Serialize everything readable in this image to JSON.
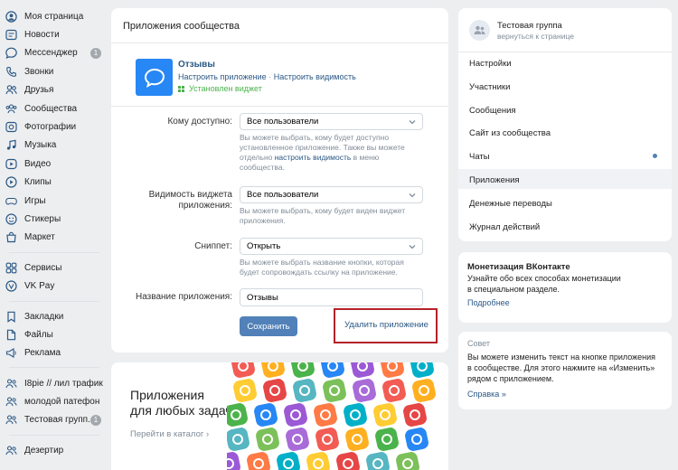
{
  "nav": {
    "items": [
      {
        "label": "Моя страница",
        "icon": "user-circle-icon"
      },
      {
        "label": "Новости",
        "icon": "news-icon"
      },
      {
        "label": "Мессенджер",
        "icon": "message-icon",
        "badge": "1"
      },
      {
        "label": "Звонки",
        "icon": "phone-icon"
      },
      {
        "label": "Друзья",
        "icon": "friends-icon"
      },
      {
        "label": "Сообщества",
        "icon": "groups-icon"
      },
      {
        "label": "Фотографии",
        "icon": "photo-icon"
      },
      {
        "label": "Музыка",
        "icon": "music-icon"
      },
      {
        "label": "Видео",
        "icon": "video-icon"
      },
      {
        "label": "Клипы",
        "icon": "clips-icon"
      },
      {
        "label": "Игры",
        "icon": "games-icon"
      },
      {
        "label": "Стикеры",
        "icon": "sticker-icon"
      },
      {
        "label": "Маркет",
        "icon": "market-icon"
      }
    ],
    "services": [
      {
        "label": "Сервисы",
        "icon": "services-icon"
      },
      {
        "label": "VK Pay",
        "icon": "vkpay-icon"
      }
    ],
    "extra": [
      {
        "label": "Закладки",
        "icon": "bookmark-icon"
      },
      {
        "label": "Файлы",
        "icon": "file-icon"
      },
      {
        "label": "Реклама",
        "icon": "ads-icon"
      }
    ],
    "groups": [
      {
        "label": "I8pie // лил трафик",
        "icon": "group-icon"
      },
      {
        "label": "молодой патефон",
        "icon": "group-icon"
      },
      {
        "label": "Тестовая групп...",
        "icon": "group-icon",
        "badge": "1"
      }
    ],
    "bottom": [
      {
        "label": "Дезертир",
        "icon": "group-icon"
      }
    ]
  },
  "main": {
    "title": "Приложения сообщества",
    "app": {
      "name": "Отзывы",
      "setup_link": "Настроить приложение",
      "dot": "·",
      "visibility_link": "Настроить видимость",
      "status": "Установлен виджет"
    },
    "form": {
      "access_label": "Кому доступно:",
      "access_value": "Все пользователи",
      "access_help_1": "Вы можете выбрать, кому будет доступно",
      "access_help_2": "установленное приложение. Также вы можете",
      "access_help_3a": "отдельно ",
      "access_help_3b": "настроить видимость",
      "access_help_3c": " в меню",
      "access_help_4": "сообщества.",
      "widget_label_1": "Видимость виджета",
      "widget_label_2": "приложения:",
      "widget_value": "Все пользователи",
      "widget_help_1": "Вы можете выбрать, кому будет виден виджет",
      "widget_help_2": "приложения.",
      "snippet_label": "Сниппет:",
      "snippet_value": "Открыть",
      "snippet_help_1": "Вы можете выбрать название кнопки, которая",
      "snippet_help_2": "будет сопровождать ссылку на приложение.",
      "name_label": "Название приложения:",
      "name_value": "Отзывы",
      "save": "Сохранить",
      "delete": "Удалить приложение"
    }
  },
  "promo": {
    "title_1": "Приложения",
    "title_2": "для любых задач",
    "catalog_link": "Перейти в каталог",
    "arrow": "›"
  },
  "side": {
    "group_name": "Тестовая группа",
    "back": "вернуться к странице",
    "menu": [
      "Настройки",
      "Участники",
      "Сообщения",
      "Сайт из сообщества",
      "Чаты",
      "Приложения",
      "Денежные переводы",
      "Журнал действий"
    ],
    "monet_title": "Монетизация ВКонтакте",
    "monet_text_1": "Узнайте обо всех способах монетизации",
    "monet_text_2": "в специальном разделе.",
    "monet_link": "Подробнее",
    "tip_title": "Совет",
    "tip_1": "Вы можете изменить текст на кнопке приложения",
    "tip_2": "в сообществе. Для этого нажмите на «Изменить»",
    "tip_3": "рядом с приложением.",
    "tip_link": "Справка",
    "tip_arrow": "»"
  },
  "colors": {
    "accent": "#2a5885",
    "button": "#5181b8",
    "highlight_box": "#b5212a",
    "app_icon": "#2787f5"
  }
}
